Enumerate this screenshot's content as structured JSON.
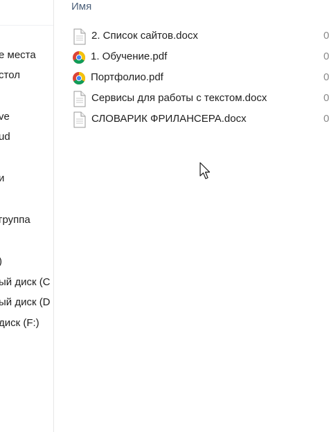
{
  "header": {
    "name_column": "Имя"
  },
  "nav": {
    "items": [
      {
        "label": "е места"
      },
      {
        "label": "стол"
      },
      {
        "label": "ve"
      },
      {
        "label": "ud"
      },
      {
        "label": "и"
      },
      {
        "label": "группа"
      },
      {
        "label": ")"
      },
      {
        "label": "ый диск (C"
      },
      {
        "label": "ый диск (D"
      },
      {
        "label": "диск (F:)"
      }
    ]
  },
  "files": [
    {
      "name": "2. Список сайтов.docx",
      "icon": "word-document-icon",
      "date_partial": "0"
    },
    {
      "name": "1. Обучение.pdf",
      "icon": "chrome-pdf-icon",
      "date_partial": "0"
    },
    {
      "name": "Портфолио.pdf",
      "icon": "chrome-pdf-icon",
      "date_partial": "0"
    },
    {
      "name": "Сервисы для работы с текстом.docx",
      "icon": "word-document-icon",
      "date_partial": "0"
    },
    {
      "name": "СЛОВАРИК ФРИЛАНСЕРА.docx",
      "icon": "word-document-icon",
      "date_partial": "0"
    }
  ],
  "colors": {
    "header_text": "#4c607a",
    "chrome_red": "#db4437",
    "chrome_yellow": "#f4c20d",
    "chrome_green": "#0f9d58",
    "chrome_blue": "#4285f4"
  }
}
